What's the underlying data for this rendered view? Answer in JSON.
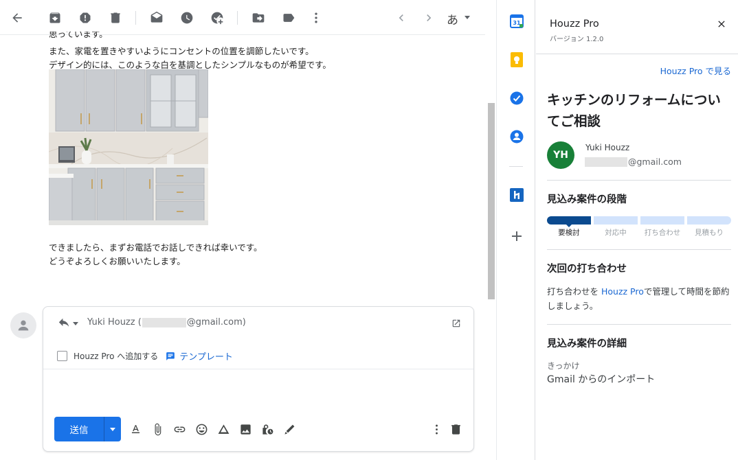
{
  "message": {
    "partial_first_line": "思っています。",
    "lines": [
      "また、家電を置きやすいようにコンセントの位置を調節したいです。",
      "デザイン的には、このような白を基調としたシンプルなものが希望です。"
    ],
    "closing": [
      "できましたら、まずお電話でお話しできれば幸いです。",
      "どうぞよろしくお願いいたします。"
    ]
  },
  "toolbar": {
    "ime_label": "あ",
    "icons": [
      "back-icon",
      "archive-icon",
      "report-spam-icon",
      "delete-icon",
      "mark-unread-icon",
      "snooze-icon",
      "add-task-icon",
      "move-to-icon",
      "label-icon",
      "more-vert-icon",
      "newer-icon",
      "older-icon"
    ]
  },
  "reply": {
    "to_name": "Yuki Houzz (",
    "to_domain": "@gmail.com)",
    "addon_label": "Houzz Pro へ追加する",
    "template_label": "テンプレート",
    "send_label": "送信"
  },
  "panel": {
    "title": "Houzz Pro",
    "version": "バージョン 1.2.0",
    "view_link": "Houzz Pro で見る",
    "subject": "キッチンのリフォームについてご相談",
    "contact": {
      "initials": "YH",
      "name": "Yuki Houzz",
      "email_domain": "@gmail.com"
    },
    "stage_heading": "見込み案件の段階",
    "stages": [
      "要検討",
      "対応中",
      "打ち合わせ",
      "見積もり"
    ],
    "current_stage": 0,
    "meeting_heading": "次回の打ち合わせ",
    "meeting_text_pre": "打ち合わせを ",
    "meeting_text_link": "Houzz Pro",
    "meeting_text_post": "で管理して時間を節約しましょう。",
    "details_heading": "見込み案件の詳細",
    "trigger_label": "きっかけ",
    "trigger_value": "Gmail からのインポート"
  },
  "colors": {
    "accent": "#1a73e8",
    "link": "#1967d2",
    "stage_active": "#0b4a8f",
    "stage_inactive": "#d2e3fc",
    "avatar": "#188038"
  }
}
